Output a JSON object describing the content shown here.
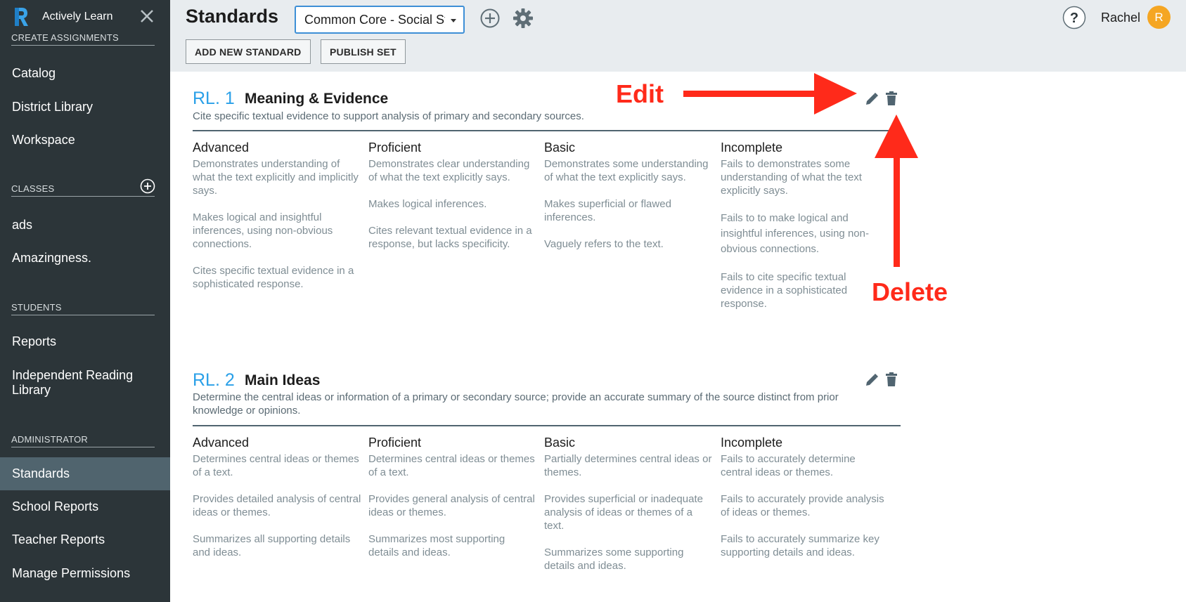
{
  "app": {
    "brand": "Actively Learn"
  },
  "sidebar": {
    "sections": [
      {
        "key": "create",
        "header": "CREATE ASSIGNMENTS",
        "items": [
          "Catalog",
          "District Library",
          "Workspace"
        ]
      },
      {
        "key": "classes",
        "header": "CLASSES",
        "items": [
          "ads",
          "Amazingness."
        ]
      },
      {
        "key": "students",
        "header": "STUDENTS",
        "items": [
          "Reports",
          "Independent Reading Library"
        ]
      },
      {
        "key": "admin",
        "header": "ADMINISTRATOR",
        "items": [
          "Standards",
          "School Reports",
          "Teacher Reports",
          "Manage Permissions"
        ]
      }
    ],
    "active_item": "Standards"
  },
  "header": {
    "title": "Standards",
    "set_select": {
      "value": "Common Core - Social Studies"
    },
    "buttons": {
      "add_new": "ADD NEW STANDARD",
      "publish": "PUBLISH SET"
    },
    "user": {
      "name": "Rachel",
      "initial": "R"
    }
  },
  "standards": [
    {
      "code": "RL. 1",
      "title": "Meaning & Evidence",
      "description": "Cite specific textual evidence to support analysis of primary and secondary sources.",
      "levels": [
        {
          "title": "Advanced",
          "criteria": [
            "Demonstrates understanding of what the text explicitly and implicitly says.",
            "Makes logical and insightful inferences, using non-obvious connections.",
            "Cites specific textual evidence in a sophisticated response."
          ]
        },
        {
          "title": "Proficient",
          "criteria": [
            "Demonstrates clear understanding of what the text explicitly says.",
            "Makes logical inferences.",
            "Cites relevant textual evidence in a response, but lacks specificity."
          ]
        },
        {
          "title": "Basic",
          "criteria": [
            "Demonstrates some understanding of what the text explicitly says.",
            "Makes superficial or flawed inferences.",
            "Vaguely refers to the text."
          ]
        },
        {
          "title": "Incomplete",
          "criteria": [
            "Fails to demonstrates some understanding of what the text explicitly says.",
            "Fails to  to make logical and insightful inferences, using non-obvious connections.",
            "Fails to cite specific textual evidence in a sophisticated response."
          ]
        }
      ]
    },
    {
      "code": "RL. 2",
      "title": "Main Ideas",
      "description": "Determine the central ideas or information of a primary or secondary source; provide an accurate summary of the source distinct from prior knowledge or opinions.",
      "levels": [
        {
          "title": "Advanced",
          "criteria": [
            "Determines central ideas or themes of a text.",
            "Provides detailed analysis of central ideas or themes.",
            "Summarizes all supporting details and ideas."
          ]
        },
        {
          "title": "Proficient",
          "criteria": [
            "Determines central ideas or themes of a text.",
            "Provides general analysis of central ideas or themes.",
            "Summarizes most supporting details and ideas."
          ]
        },
        {
          "title": "Basic",
          "criteria": [
            "Partially determines central ideas or themes.",
            "Provides superficial or inadequate analysis of ideas or themes of a text.",
            "Summarizes some supporting details and ideas."
          ]
        },
        {
          "title": "Incomplete",
          "criteria": [
            "Fails to accurately determine central ideas or themes.",
            "Fails to accurately provide analysis of ideas or themes.",
            "Fails to accurately summarize key supporting details and ideas."
          ]
        }
      ]
    }
  ],
  "annotations": {
    "edit": "Edit",
    "delete": "Delete",
    "color": "#ff2a1a"
  },
  "colors": {
    "sidebar": "#2c3539",
    "sidebar_active": "#50646e",
    "accent": "#2aa0e8",
    "avatar": "#f5a623"
  }
}
